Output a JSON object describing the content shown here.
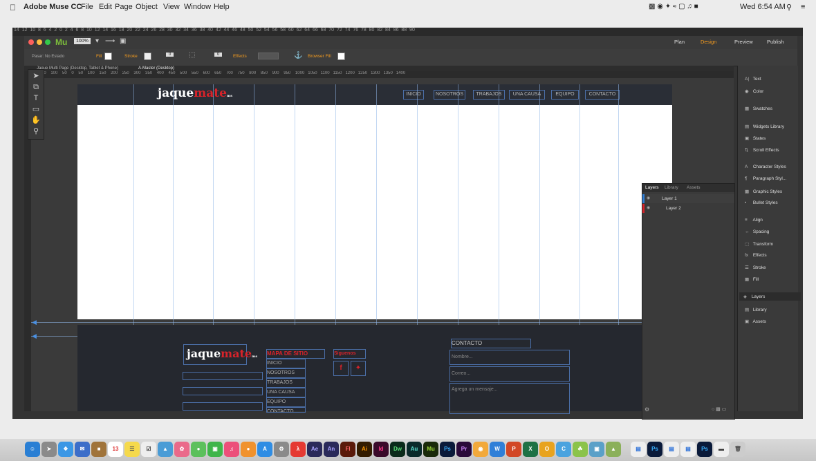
{
  "menubar": {
    "app_name": "Adobe Muse CC",
    "items": [
      "File",
      "Edit",
      "Page",
      "Object",
      "View",
      "Window",
      "Help"
    ],
    "clock": "Wed 6:54 AM"
  },
  "titlebar": {
    "app_mark": "Mu",
    "zoom": "100%",
    "modes": {
      "plan": "Plan",
      "design": "Design",
      "preview": "Preview",
      "publish": "Publish"
    }
  },
  "toolbar": {
    "state_label": "Pasar: No Estado",
    "fill_label": "Fill",
    "stroke_label": "Stroke",
    "stroke_value": "0",
    "opacity_value": "0",
    "effects_label": "Effects",
    "browser_fill_label": "Browser Fill"
  },
  "tabs": {
    "tab1": "Jaque Multi Page (Desktop, Tablet & Phone)",
    "tab2": "A-Master (Desktop)"
  },
  "site": {
    "logo_main": "jaque",
    "logo_red": "mate",
    "logo_suffix": "ms",
    "nav": [
      "INICIO",
      "NOSOTROS",
      "TRABAJOS",
      "UNA CAUSA",
      "EQUIPO",
      "CONTACTO"
    ],
    "sitemap_title": "MAPA DE SITIO",
    "sitemap_items": [
      "INICIO",
      "NOSOTROS",
      "TRABAJOS",
      "UNA CAUSA",
      "EQUIPO",
      "CONTACTO"
    ],
    "follow_title": "Síguenos",
    "contact_title": "CONTACTO",
    "name_placeholder": "Nombre...",
    "email_placeholder": "Correo...",
    "message_placeholder": "Agrega un mensaje..."
  },
  "panels": {
    "items": [
      "Text",
      "Color",
      "Swatches",
      "Widgets Library",
      "States",
      "Scroll Effects",
      "Character Styles",
      "Paragraph Styl...",
      "Graphic Styles",
      "Bullet Styles",
      "Align",
      "Spacing",
      "Transform",
      "Effects",
      "Stroke",
      "Fill",
      "Layers",
      "Library",
      "Assets"
    ]
  },
  "layers_panel": {
    "tabs": [
      "Layers",
      "Library",
      "Assets"
    ],
    "rows": [
      "Layer 1",
      "Layer 2"
    ]
  }
}
